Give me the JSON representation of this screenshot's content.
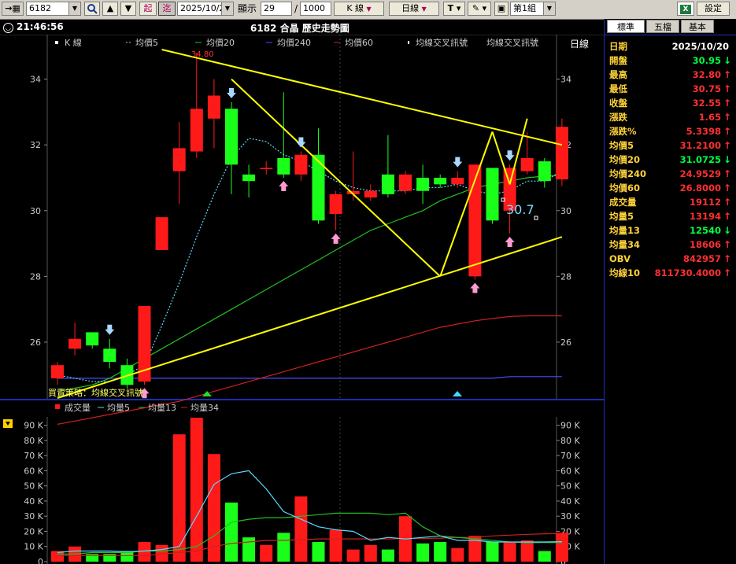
{
  "toolbar": {
    "symbol": "6182",
    "start_label": "起",
    "end_label": "迄",
    "date": "2025/10/20",
    "show_label": "顯示",
    "show_count": "29",
    "slash": "/",
    "total": "1000",
    "kline_label": "K 線",
    "daily_label": "日線",
    "group_label": "第1組",
    "settings_label": "設定"
  },
  "chart": {
    "clock": "21:46:56",
    "title": "6182 合晶  歷史走勢圖",
    "period": "日線",
    "legend": [
      "K 線",
      "均價5",
      "均價20",
      "均價240",
      "均價60",
      "均線交叉訊號",
      "均線交叉訊號"
    ],
    "strategy_label": "買賣策略：均線交叉訊號",
    "price_high_label": "34.80",
    "annotation_price": "30.7",
    "price_ticks": [
      "34",
      "32",
      "30",
      "28",
      "26"
    ],
    "vol_legend": [
      "成交量",
      "均量5",
      "均量13",
      "均量34"
    ],
    "vol_ticks": [
      "90 K",
      "80 K",
      "70 K",
      "60 K",
      "50 K",
      "40 K",
      "30 K",
      "20 K",
      "10 K",
      "0"
    ]
  },
  "colors": {
    "up": "#ff1a1a",
    "down": "#1aff1a",
    "ma5": "#5ad8ff",
    "ma20": "#20c020",
    "ma240": "#4b4bff",
    "ma60": "#cc2020",
    "trend": "#ffff00",
    "panel_key": "#ffd23a"
  },
  "chart_data": {
    "type": "candlestick",
    "scale": {
      "price_min": 24.3,
      "price_max": 34.9,
      "volume_max": 95000
    },
    "candles": [
      {
        "o": 24.9,
        "c": 25.3,
        "h": 25.4,
        "l": 24.7,
        "v": 7000
      },
      {
        "o": 25.8,
        "c": 26.1,
        "h": 26.6,
        "l": 25.6,
        "v": 10000
      },
      {
        "o": 26.3,
        "c": 25.9,
        "h": 26.3,
        "l": 25.8,
        "v": 5000
      },
      {
        "o": 25.8,
        "c": 25.4,
        "h": 26.1,
        "l": 25.2,
        "v": 5000
      },
      {
        "o": 25.3,
        "c": 24.7,
        "h": 25.5,
        "l": 24.6,
        "v": 7000
      },
      {
        "o": 24.8,
        "c": 27.1,
        "h": 27.1,
        "l": 24.7,
        "v": 13000
      },
      {
        "o": 28.8,
        "c": 29.8,
        "h": 29.8,
        "l": 28.8,
        "v": 11000
      },
      {
        "o": 31.2,
        "c": 31.9,
        "h": 32.7,
        "l": 30.2,
        "v": 84000
      },
      {
        "o": 31.8,
        "c": 33.1,
        "h": 34.8,
        "l": 31.6,
        "v": 95000
      },
      {
        "o": 32.8,
        "c": 33.5,
        "h": 34.0,
        "l": 31.9,
        "v": 71000
      },
      {
        "o": 33.1,
        "c": 31.4,
        "h": 33.3,
        "l": 30.5,
        "v": 39000
      },
      {
        "o": 31.1,
        "c": 30.9,
        "h": 31.4,
        "l": 30.4,
        "v": 16000
      },
      {
        "o": 31.3,
        "c": 31.3,
        "h": 31.5,
        "l": 31.1,
        "v": 11000
      },
      {
        "o": 31.6,
        "c": 31.1,
        "h": 33.6,
        "l": 31.0,
        "v": 19000
      },
      {
        "o": 31.1,
        "c": 31.7,
        "h": 31.8,
        "l": 30.9,
        "v": 43000
      },
      {
        "o": 31.7,
        "c": 29.7,
        "h": 32.5,
        "l": 29.6,
        "v": 13000
      },
      {
        "o": 29.9,
        "c": 30.5,
        "h": 30.6,
        "l": 29.4,
        "v": 21000
      },
      {
        "o": 30.5,
        "c": 30.6,
        "h": 31.8,
        "l": 30.3,
        "v": 8000
      },
      {
        "o": 30.4,
        "c": 30.6,
        "h": 30.8,
        "l": 30.3,
        "v": 11000
      },
      {
        "o": 31.1,
        "c": 30.5,
        "h": 32.3,
        "l": 30.4,
        "v": 8000
      },
      {
        "o": 30.6,
        "c": 31.1,
        "h": 31.2,
        "l": 30.5,
        "v": 30000
      },
      {
        "o": 31.0,
        "c": 30.6,
        "h": 31.4,
        "l": 30.2,
        "v": 12000
      },
      {
        "o": 31.0,
        "c": 30.8,
        "h": 31.1,
        "l": 30.7,
        "v": 13000
      },
      {
        "o": 30.8,
        "c": 31.0,
        "h": 31.2,
        "l": 30.7,
        "v": 9000
      },
      {
        "o": 28.0,
        "c": 31.4,
        "h": 31.4,
        "l": 27.9,
        "v": 17000
      },
      {
        "o": 31.3,
        "c": 29.7,
        "h": 31.3,
        "l": 29.6,
        "v": 13000
      },
      {
        "o": 30.0,
        "c": 31.3,
        "h": 31.4,
        "l": 29.3,
        "v": 13000
      },
      {
        "o": 31.2,
        "c": 31.6,
        "h": 32.4,
        "l": 31.1,
        "v": 14000
      },
      {
        "o": 31.5,
        "c": 30.9,
        "h": 31.6,
        "l": 30.7,
        "v": 7000
      },
      {
        "o": 30.95,
        "c": 32.55,
        "h": 32.8,
        "l": 30.75,
        "v": 19112
      }
    ],
    "ma5": [
      25.0,
      24.9,
      24.8,
      24.8,
      25.0,
      25.3,
      26.5,
      27.8,
      29.2,
      30.5,
      31.6,
      32.2,
      32.1,
      31.7,
      31.5,
      31.2,
      30.9,
      30.7,
      30.6,
      30.6,
      30.6,
      30.7,
      30.7,
      30.8,
      30.6,
      30.5,
      30.6,
      30.9,
      30.9,
      31.21
    ],
    "ma20": [
      24.5,
      24.6,
      24.7,
      24.9,
      25.2,
      25.5,
      25.8,
      26.1,
      26.4,
      26.7,
      27.0,
      27.3,
      27.6,
      27.9,
      28.2,
      28.5,
      28.8,
      29.1,
      29.4,
      29.6,
      29.8,
      30.0,
      30.3,
      30.5,
      30.7,
      30.8,
      30.9,
      31.0,
      31.05,
      31.07
    ],
    "ma240": [
      24.9,
      24.9,
      24.9,
      24.9,
      24.9,
      24.9,
      24.9,
      24.9,
      24.9,
      24.9,
      24.9,
      24.9,
      24.9,
      24.9,
      24.9,
      24.9,
      24.9,
      24.9,
      24.9,
      24.9,
      24.9,
      24.9,
      24.9,
      24.9,
      24.9,
      24.9,
      24.95,
      24.95,
      24.95,
      24.95
    ],
    "ma60": [
      23.5,
      23.6,
      23.7,
      23.8,
      23.9,
      24.0,
      24.1,
      24.2,
      24.35,
      24.5,
      24.65,
      24.8,
      24.95,
      25.1,
      25.25,
      25.4,
      25.55,
      25.7,
      25.85,
      26.0,
      26.15,
      26.3,
      26.45,
      26.55,
      26.65,
      26.72,
      26.78,
      26.8,
      26.8,
      26.8
    ],
    "vma5": [
      6000,
      7000,
      7000,
      7000,
      6500,
      7000,
      8000,
      10000,
      30000,
      51000,
      58000,
      60000,
      48000,
      33000,
      28000,
      23000,
      21000,
      20000,
      14000,
      16000,
      15000,
      16000,
      17000,
      14000,
      14000,
      13000,
      13000,
      13000,
      13000,
      13194
    ],
    "vma13": [
      5000,
      5000,
      6000,
      6000,
      6000,
      7000,
      7000,
      8000,
      10000,
      17000,
      26000,
      28000,
      29000,
      29000,
      30000,
      31000,
      32000,
      32000,
      32000,
      31000,
      32000,
      23000,
      17000,
      16000,
      15000,
      14000,
      13000,
      12500,
      12600,
      12540
    ],
    "vma34": [
      4000,
      4000,
      4000,
      4000,
      4000,
      4000,
      5000,
      6000,
      7000,
      10000,
      12000,
      13000,
      14000,
      14000,
      14500,
      15000,
      15000,
      15000,
      15000,
      15000,
      15200,
      15300,
      15500,
      16000,
      16000,
      17000,
      17500,
      18000,
      18400,
      18606
    ],
    "trendlines": [
      {
        "from": [
          0,
          24.3
        ],
        "to": [
          29,
          29.2
        ]
      },
      {
        "from": [
          6,
          34.9
        ],
        "to": [
          29,
          32.0
        ]
      },
      {
        "from": [
          10,
          34.0
        ],
        "to": [
          22,
          28.0
        ]
      },
      {
        "from": [
          22,
          28.0
        ],
        "to": [
          25,
          32.4
        ]
      },
      {
        "from": [
          25,
          32.4
        ],
        "to": [
          26,
          30.8
        ]
      },
      {
        "from": [
          26,
          30.8
        ],
        "to": [
          27,
          32.8
        ]
      }
    ],
    "sell_signals": [
      3,
      10,
      14,
      23,
      26
    ],
    "buy_signals": [
      5,
      13,
      16,
      24,
      26
    ]
  },
  "panel": {
    "tabs": [
      "標準",
      "五檔",
      "基本"
    ],
    "rows": [
      {
        "k": "日期",
        "v": "2025/10/20",
        "c": "wht",
        "a": ""
      },
      {
        "k": "開盤",
        "v": "30.95",
        "c": "grn",
        "a": "↓"
      },
      {
        "k": "最高",
        "v": "32.80",
        "c": "red",
        "a": "↑"
      },
      {
        "k": "最低",
        "v": "30.75",
        "c": "red",
        "a": "↑"
      },
      {
        "k": "收盤",
        "v": "32.55",
        "c": "red",
        "a": "↑"
      },
      {
        "k": "漲跌",
        "v": "1.65",
        "c": "red",
        "a": "↑"
      },
      {
        "k": "漲跌%",
        "v": "5.3398",
        "c": "red",
        "a": "↑"
      },
      {
        "k": "均價5",
        "v": "31.2100",
        "c": "red",
        "a": "↑"
      },
      {
        "k": "均價20",
        "v": "31.0725",
        "c": "grn",
        "a": "↓"
      },
      {
        "k": "均價240",
        "v": "24.9529",
        "c": "red",
        "a": "↑"
      },
      {
        "k": "均價60",
        "v": "26.8000",
        "c": "red",
        "a": "↑"
      },
      {
        "k": "成交量",
        "v": "19112",
        "c": "red",
        "a": "↑"
      },
      {
        "k": "均量5",
        "v": "13194",
        "c": "red",
        "a": "↑"
      },
      {
        "k": "均量13",
        "v": "12540",
        "c": "grn",
        "a": "↓"
      },
      {
        "k": "均量34",
        "v": "18606",
        "c": "red",
        "a": "↑"
      },
      {
        "k": "OBV",
        "v": "842957",
        "c": "red",
        "a": "↑"
      },
      {
        "k": "均線10",
        "v": "811730.4000",
        "c": "red",
        "a": "↑"
      }
    ]
  }
}
